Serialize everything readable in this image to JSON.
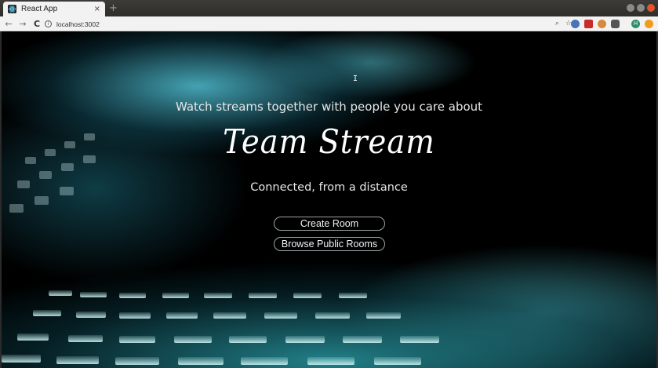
{
  "browser": {
    "tab_title": "React App",
    "tab_close": "×",
    "new_tab": "+",
    "back": "←",
    "forward": "→",
    "reload": "C",
    "info": "i",
    "url": "localhost:3002",
    "zoom_icon": "⌕",
    "bookmark_icon": "☆",
    "profile_initial": "H"
  },
  "page": {
    "tagline": "Watch streams together with people you care about",
    "title": "Team Stream",
    "subtitle": "Connected, from a distance",
    "buttons": {
      "create_room": "Create Room",
      "browse_public_rooms": "Browse Public Rooms"
    }
  },
  "colors": {
    "accent_teal": "#3aa7b4",
    "background": "#000000",
    "text": "#e6e6e6"
  }
}
